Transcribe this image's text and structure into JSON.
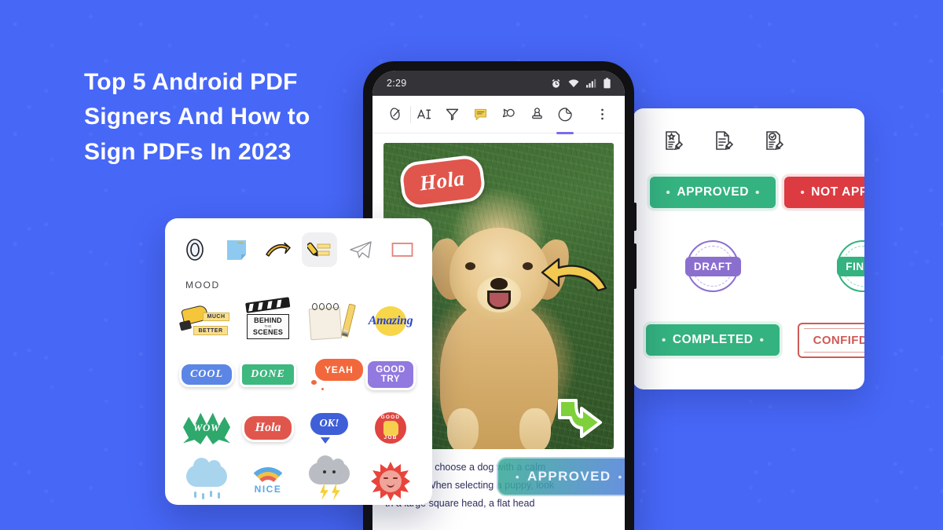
{
  "page": {
    "background_color": "#4767f7",
    "headline": "Top 5 Android PDF Signers And How to Sign PDFs In 2023"
  },
  "phone": {
    "status_bar": {
      "time": "2:29",
      "icons": [
        "alarm-icon",
        "wifi-icon",
        "signal-icon",
        "battery-icon"
      ]
    },
    "toolbar": {
      "items": [
        {
          "name": "signature-tool",
          "icon": "signature-icon",
          "active": false
        },
        {
          "name": "text-tool",
          "icon": "text-a-icon",
          "active": false
        },
        {
          "name": "highlighter-tool",
          "icon": "highlighter-icon",
          "active": false
        },
        {
          "name": "comment-tool",
          "icon": "comment-icon",
          "active": false
        },
        {
          "name": "shape-tool",
          "icon": "cloud-shape-icon",
          "active": false
        },
        {
          "name": "stamp-tool",
          "icon": "stamp-icon",
          "active": false
        },
        {
          "name": "sticker-tool",
          "icon": "sticker-icon",
          "active": true
        }
      ],
      "overflow": "more-vertical-icon"
    },
    "document": {
      "photo_alt": "golden retriever dog sitting on grass",
      "placed_stickers": [
        {
          "name": "hola-sticker",
          "label": "Hola",
          "color": "#e0564c"
        },
        {
          "name": "yellow-arrow-sticker",
          "label": "",
          "color": "#f2c94c"
        },
        {
          "name": "green-arrow-sticker",
          "label": "",
          "color": "#7ed321"
        }
      ],
      "text_lines": [
        "dvisable to choose a dog with a calm",
        "erament. When selecting a puppy, look",
        "th a large square head, a flat head"
      ],
      "approved_overlay": {
        "label": "APPROVED",
        "dot": "•"
      }
    }
  },
  "sticker_panel": {
    "tabs": [
      {
        "name": "recent-tab",
        "icon": "zero-oval-icon",
        "active": false
      },
      {
        "name": "sticky-note-tab",
        "icon": "sticky-note-icon",
        "active": false
      },
      {
        "name": "arrow-tab",
        "icon": "curved-arrow-icon",
        "active": false
      },
      {
        "name": "highlighter-tab",
        "icon": "highlighter-sticker-icon",
        "active": true
      },
      {
        "name": "paper-plane-tab",
        "icon": "paper-plane-icon",
        "active": false
      },
      {
        "name": "rectangle-tab",
        "icon": "rectangle-icon",
        "active": false
      }
    ],
    "category_label": "MOOD",
    "stickers": [
      {
        "name": "much-better-sticker",
        "line1": "MUCH",
        "line2": "BETTER"
      },
      {
        "name": "behind-the-scenes-sticker",
        "line1": "BEHIND",
        "line2": "THE",
        "line3": "SCENES"
      },
      {
        "name": "notepad-pencil-sticker",
        "label": ""
      },
      {
        "name": "amazing-sticker",
        "label": "Amazing"
      },
      {
        "name": "cool-sticker",
        "label": "COOL"
      },
      {
        "name": "done-sticker",
        "label": "DONE"
      },
      {
        "name": "yeah-sticker",
        "label": "YEAH"
      },
      {
        "name": "good-try-sticker",
        "line1": "GOOD",
        "line2": "TRY"
      },
      {
        "name": "wow-sticker",
        "label": "WOW"
      },
      {
        "name": "hola-sticker",
        "label": "Hola"
      },
      {
        "name": "ok-sticker",
        "label": "OK!"
      },
      {
        "name": "good-job-sticker",
        "line1": "GOOD",
        "line2": "JOB"
      },
      {
        "name": "rain-cloud-sticker",
        "label": ""
      },
      {
        "name": "rainbow-nice-sticker",
        "label": "NICE"
      },
      {
        "name": "storm-cloud-sticker",
        "label": ""
      },
      {
        "name": "sun-sticker",
        "label": ""
      }
    ]
  },
  "stamp_panel": {
    "tabs": [
      {
        "name": "star-stamp-tab",
        "icon": "document-star-stamp-icon"
      },
      {
        "name": "text-stamp-tab",
        "icon": "document-lines-stamp-icon"
      },
      {
        "name": "check-stamp-tab",
        "icon": "document-check-stamp-icon"
      }
    ],
    "stamps": [
      {
        "name": "approved-stamp",
        "label": "APPROVED",
        "style": "pill-green",
        "color": "#34b27f"
      },
      {
        "name": "not-approved-stamp",
        "label": "NOT APPROVED",
        "style": "pill-red",
        "color": "#db3b41"
      },
      {
        "name": "draft-stamp",
        "label": "DRAFT",
        "style": "seal-draft",
        "color": "#8b6fcf"
      },
      {
        "name": "final-stamp",
        "label": "FINAL",
        "style": "seal-final",
        "color": "#34b27f"
      },
      {
        "name": "completed-stamp",
        "label": "COMPLETED",
        "style": "pill-green",
        "color": "#34b27f"
      },
      {
        "name": "confidential-stamp",
        "label": "CONFIFDENTIAL",
        "style": "outline-red",
        "color": "#cf5a58"
      }
    ]
  }
}
